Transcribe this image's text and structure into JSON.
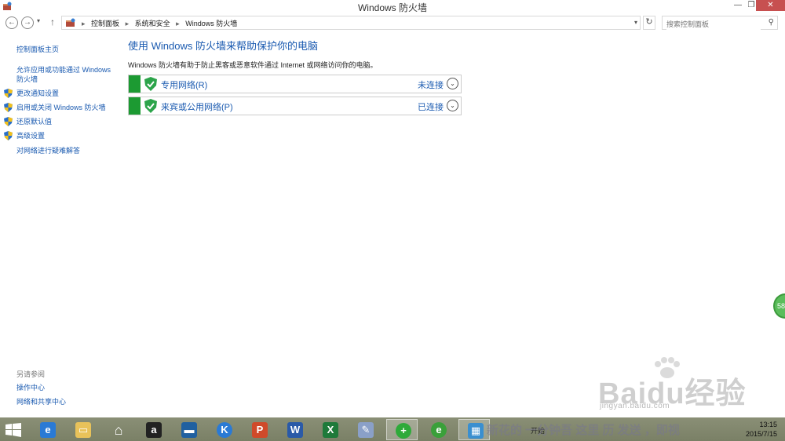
{
  "window": {
    "title": "Windows 防火墙",
    "controls": {
      "minimize": "—",
      "restore": "❐",
      "close": "✕"
    }
  },
  "address": {
    "crumbs": [
      "控制面板",
      "系统和安全",
      "Windows 防火墙"
    ],
    "search_placeholder": "搜索控制面板"
  },
  "sidebar": {
    "home": "控制面板主页",
    "allow_app": "允许应用或功能通过 Windows 防火墙",
    "items": [
      {
        "label": "更改通知设置"
      },
      {
        "label": "启用或关闭 Windows 防火墙"
      },
      {
        "label": "还原默认值"
      },
      {
        "label": "高级设置"
      }
    ],
    "troubleshoot": "对网络进行疑难解答",
    "see_also": "另请参阅",
    "see_also_links": [
      "操作中心",
      "网络和共享中心"
    ]
  },
  "main": {
    "title": "使用 Windows 防火墙来帮助保护你的电脑",
    "description": "Windows 防火墙有助于防止黑客或恶意软件通过 Internet 或网络访问你的电脑。",
    "networks": [
      {
        "name": "专用网络(R)",
        "status": "未连接"
      },
      {
        "name": "来宾或公用网络(P)",
        "status": "已连接"
      }
    ]
  },
  "floating_badge": "58",
  "watermark": {
    "text": "Baidu经验",
    "sub": "jingyan.baidu.com"
  },
  "taskbar": {
    "tray_label": "开始",
    "clock_time": "13:15",
    "clock_date": "2015/7/15",
    "band_text": "新花的 一分钟吾 这里 历 发送 ，即视"
  },
  "colors": {
    "accent": "#1a5ab0",
    "firewall_green": "#1c9a32",
    "close_red": "#c75050"
  }
}
